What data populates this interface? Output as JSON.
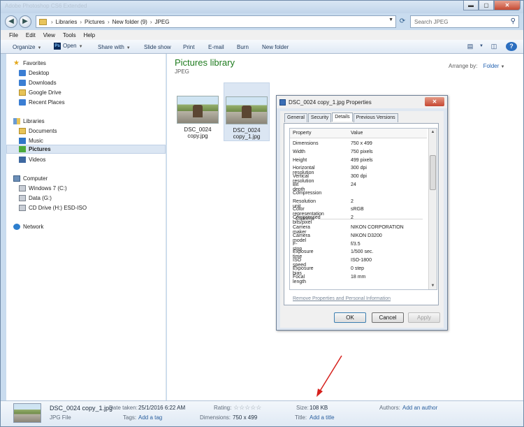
{
  "window": {
    "title": "Adobe Photoshop CS6 Extended",
    "buttons": {
      "minimize": "▬",
      "maximize": "▢",
      "close": "✕"
    }
  },
  "address": {
    "crumbs": [
      "Libraries",
      "Pictures",
      "New folder (9)",
      "JPEG"
    ],
    "search_placeholder": "Search JPEG"
  },
  "menu": [
    "File",
    "Edit",
    "View",
    "Tools",
    "Help"
  ],
  "toolbar": {
    "organize": "Organize",
    "open": "Open",
    "share": "Share with",
    "slideshow": "Slide show",
    "print": "Print",
    "email": "E-mail",
    "burn": "Burn",
    "new_folder": "New folder"
  },
  "nav": {
    "favorites": "Favorites",
    "desktop": "Desktop",
    "downloads": "Downloads",
    "google_drive": "Google Drive",
    "recent": "Recent Places",
    "libraries": "Libraries",
    "documents": "Documents",
    "music": "Music",
    "pictures": "Pictures",
    "videos": "Videos",
    "computer": "Computer",
    "win7": "Windows 7 (C:)",
    "data": "Data (G:)",
    "cd": "CD Drive (H:) ESD-ISO",
    "network": "Network"
  },
  "content": {
    "title": "Pictures library",
    "subtitle": "JPEG",
    "arrange_label": "Arrange by:",
    "arrange_value": "Folder",
    "files": [
      {
        "line1": "DSC_0024",
        "line2": "copy.jpg"
      },
      {
        "line1": "DSC_0024",
        "line2": "copy_1.jpg"
      }
    ]
  },
  "dialog": {
    "title": "DSC_0024 copy_1.jpg Properties",
    "close": "✕",
    "tabs": [
      "General",
      "Security",
      "Details",
      "Previous Versions"
    ],
    "active_tab": "Details",
    "col_property": "Property",
    "col_value": "Value",
    "rows": [
      {
        "k": "Dimensions",
        "v": "750 x 499"
      },
      {
        "k": "Width",
        "v": "750 pixels"
      },
      {
        "k": "Height",
        "v": "499 pixels"
      },
      {
        "k": "Horizontal resolution",
        "v": "300 dpi"
      },
      {
        "k": "Vertical resolution",
        "v": "300 dpi"
      },
      {
        "k": "Bit depth",
        "v": "24"
      },
      {
        "k": "Compression",
        "v": ""
      },
      {
        "k": "Resolution unit",
        "v": "2"
      },
      {
        "k": "Color representation",
        "v": "sRGB"
      },
      {
        "k": "Compressed bits/pixel",
        "v": "2"
      }
    ],
    "camera_group": "Camera",
    "camera_rows": [
      {
        "k": "Camera maker",
        "v": "NIKON CORPORATION"
      },
      {
        "k": "Camera model",
        "v": "NIKON D3200"
      },
      {
        "k": "F-stop",
        "v": "f/3.5"
      },
      {
        "k": "Exposure time",
        "v": "1/500 sec."
      },
      {
        "k": "ISO speed",
        "v": "ISO-1800"
      },
      {
        "k": "Exposure bias",
        "v": "0 step"
      },
      {
        "k": "Focal length",
        "v": "18 mm"
      }
    ],
    "remove_link": "Remove Properties and Personal Information",
    "ok": "OK",
    "cancel": "Cancel",
    "apply": "Apply"
  },
  "details_pane": {
    "filename": "DSC_0024 copy_1.jpg",
    "filetype": "JPG File",
    "date_label": "Date taken:",
    "date_value": "25/1/2016 6:22 AM",
    "tags_label": "Tags:",
    "tags_value": "Add a tag",
    "rating_label": "Rating:",
    "rating_stars": "☆☆☆☆☆",
    "rating_value": 0,
    "dim_label": "Dimensions:",
    "dim_value": "750 x 499",
    "size_label": "Size:",
    "size_value": "108 KB",
    "title_label": "Title:",
    "title_value": "Add a title",
    "authors_label": "Authors:",
    "authors_value": "Add an author"
  },
  "colors": {
    "library_title": "#1e7b1e",
    "link": "#2a5f9e",
    "annotation_arrow": "#d6201c"
  }
}
